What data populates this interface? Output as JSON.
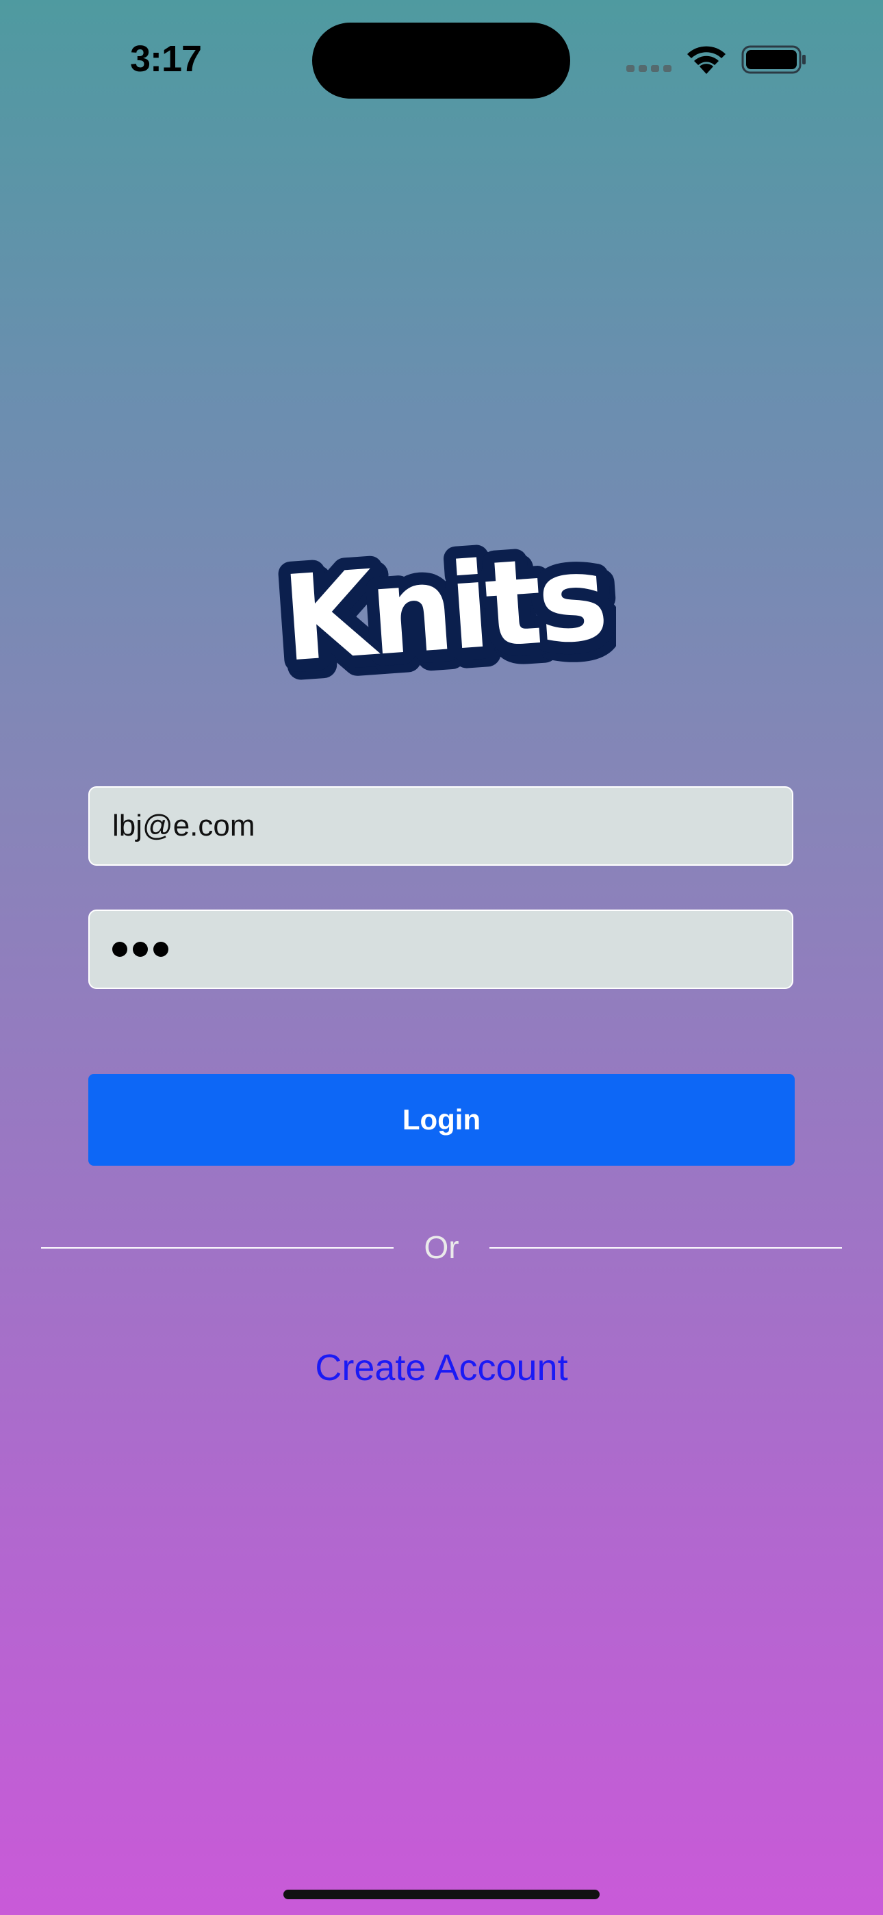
{
  "status_bar": {
    "time": "3:17"
  },
  "logo": {
    "text": "Knits",
    "fill_color": "#ffffff",
    "outline_color": "#0b1f4d"
  },
  "login_form": {
    "email_value": "lbj@e.com",
    "password_mask_count": 3,
    "login_label": "Login",
    "divider_label": "Or",
    "create_account_label": "Create Account"
  },
  "colors": {
    "button": "#0d67f6",
    "link": "#1a1af5",
    "field_background": "#d7dfdf",
    "gradient_top": "#4f9aa0",
    "gradient_bottom": "#c95ad8"
  },
  "icons": [
    "signal-icon",
    "wifi-icon",
    "battery-icon"
  ]
}
